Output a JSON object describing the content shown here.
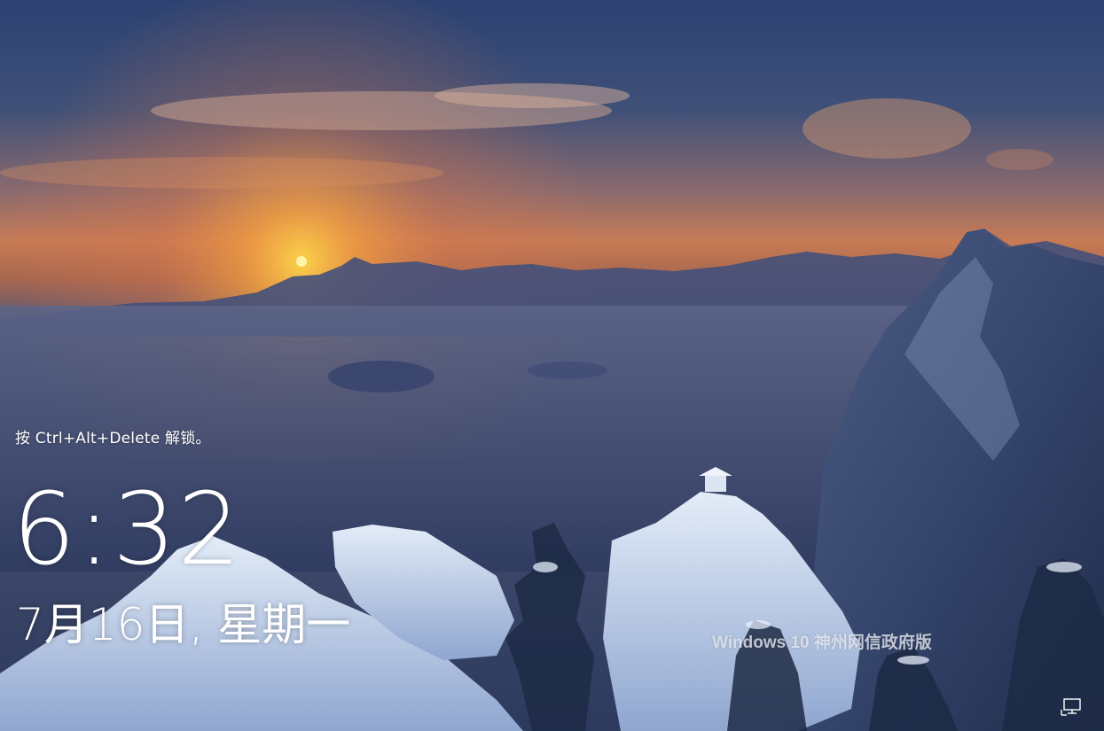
{
  "lock_screen": {
    "unlock_hint": "按 Ctrl+Alt+Delete 解锁。",
    "time": "6:32",
    "date": "7月16日, 星期一",
    "watermark": "Windows 10 神州网信政府版"
  },
  "icons": {
    "network": "network-icon"
  },
  "colors": {
    "text": "#ffffff",
    "sunset": "#f3a54a",
    "sky_top": "#2e4370",
    "snow": "#dfe8f5"
  }
}
